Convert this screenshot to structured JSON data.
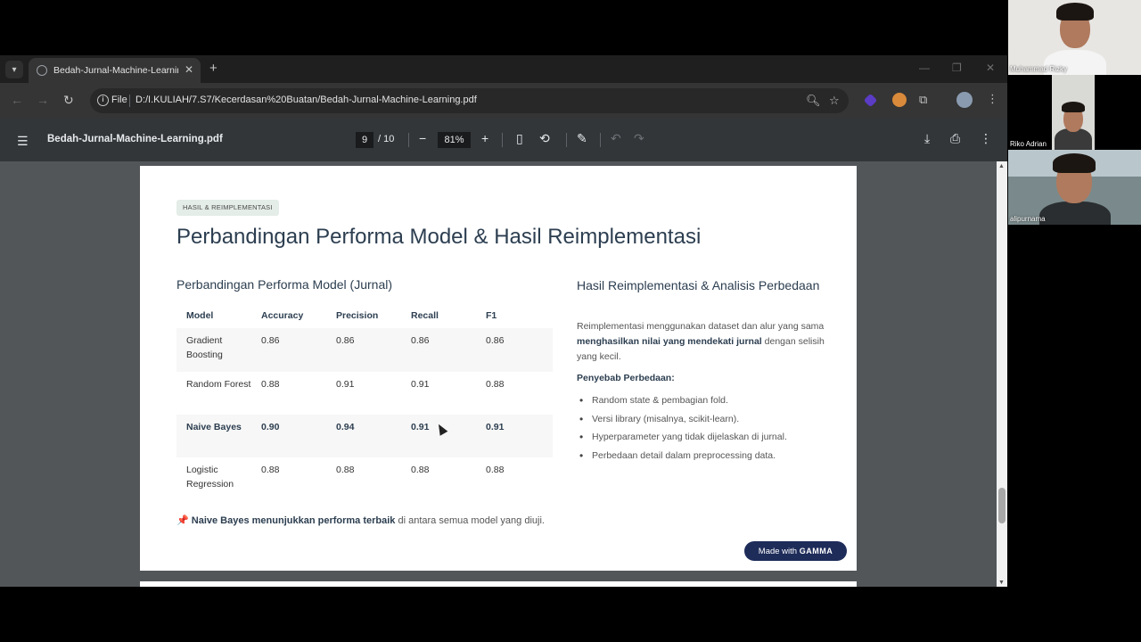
{
  "browser": {
    "tab_title": "Bedah-Jurnal-Machine-Learning",
    "address_scheme": "File",
    "address_url": "D:/I.KULIAH/7.S7/Kecerdasan%20Buatan/Bedah-Jurnal-Machine-Learning.pdf"
  },
  "pdf_toolbar": {
    "filename": "Bedah-Jurnal-Machine-Learning.pdf",
    "current_page": "9",
    "total_pages": "/ 10",
    "zoom": "81%"
  },
  "slide": {
    "badge": "HASIL & REIMPLEMENTASI",
    "title": "Perbandingan Performa Model & Hasil Reimplementasi",
    "left_heading": "Perbandingan Performa Model (Jurnal)",
    "table": {
      "headers": [
        "Model",
        "Accuracy",
        "Precision",
        "Recall",
        "F1"
      ],
      "rows": [
        {
          "model": "Gradient Boosting",
          "accuracy": "0.86",
          "precision": "0.86",
          "recall": "0.86",
          "f1": "0.86"
        },
        {
          "model": "Random Forest",
          "accuracy": "0.88",
          "precision": "0.91",
          "recall": "0.91",
          "f1": "0.88"
        },
        {
          "model": "Naive Bayes",
          "accuracy": "0.90",
          "precision": "0.94",
          "recall": "0.91",
          "f1": "0.91"
        },
        {
          "model": "Logistic Regression",
          "accuracy": "0.88",
          "precision": "0.88",
          "recall": "0.88",
          "f1": "0.88"
        }
      ]
    },
    "note_pin": "📌",
    "note_bold": "Naive Bayes menunjukkan performa terbaik",
    "note_rest": " di antara semua model yang diuji.",
    "right_heading": "Hasil Reimplementasi & Analisis Perbedaan",
    "right_para_1": "Reimplementasi menggunakan dataset dan alur yang sama ",
    "right_para_bold": "menghasilkan nilai yang mendekati jurnal",
    "right_para_2": " dengan selisih yang kecil.",
    "cause_title": "Penyebab Perbedaan:",
    "causes": [
      "Random state & pembagian fold.",
      "Versi library (misalnya, scikit-learn).",
      "Hyperparameter yang tidak dijelaskan di jurnal.",
      "Perbedaan detail dalam preprocessing data."
    ],
    "made_with": "Made with ",
    "gamma": "GAMMA"
  },
  "participants": [
    {
      "name": "Muhammad Rizky"
    },
    {
      "name": "Riko Adrian"
    },
    {
      "name": "alipurnama"
    }
  ]
}
